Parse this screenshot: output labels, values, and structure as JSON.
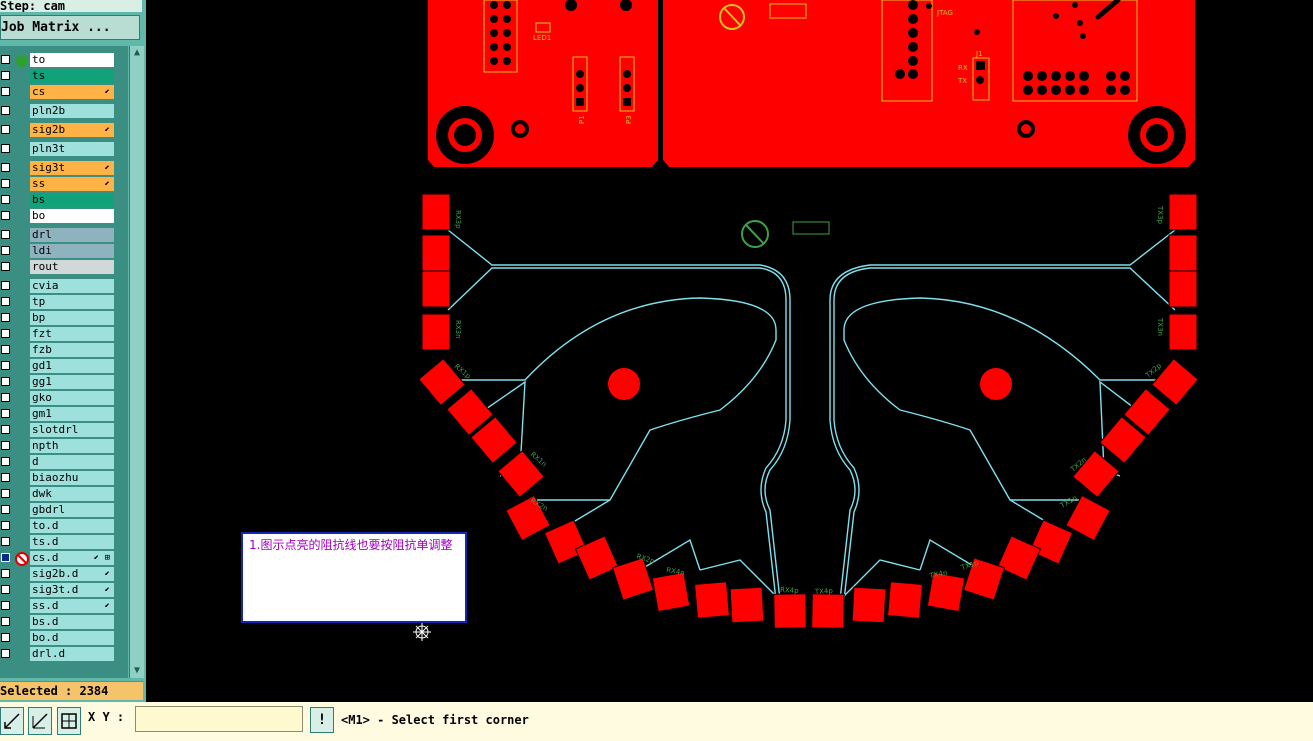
{
  "step_label": "Step: cam",
  "job_matrix_label": "Job Matrix ...",
  "colors": {
    "board": "#ff0000",
    "trace": "#7fe0ee",
    "silk": "#3ea04a",
    "silk_yellow": "#d8c020",
    "signal_layer": "#ffb347",
    "solder_layer": "#12a27a",
    "drill_layer": "#8fb2bf",
    "default_layer": "#9ee0dc",
    "white_layer": "#ffffff"
  },
  "layers": [
    {
      "name": "to",
      "color": "#ffffff",
      "indicator": "active-dot"
    },
    {
      "name": "ts",
      "color": "#12a27a"
    },
    {
      "name": "cs",
      "color": "#ffb347",
      "mark": "⬋"
    },
    {
      "name": "pln2b",
      "color": "#9ee0dc"
    },
    {
      "name": "sig2b",
      "color": "#ffb347",
      "mark": "⬋"
    },
    {
      "name": "pln3t",
      "color": "#9ee0dc"
    },
    {
      "name": "sig3t",
      "color": "#ffb347",
      "mark": "⬋"
    },
    {
      "name": "ss",
      "color": "#ffb347",
      "mark": "⬋"
    },
    {
      "name": "bs",
      "color": "#12a27a"
    },
    {
      "name": "bo",
      "color": "#ffffff"
    },
    {
      "name": "drl",
      "color": "#8fb2bf"
    },
    {
      "name": "ldi",
      "color": "#8fb2bf"
    },
    {
      "name": "rout",
      "color": "#d0d8d8"
    },
    {
      "name": "cvia",
      "color": "#9ee0dc"
    },
    {
      "name": "tp",
      "color": "#9ee0dc"
    },
    {
      "name": "bp",
      "color": "#9ee0dc"
    },
    {
      "name": "fzt",
      "color": "#9ee0dc"
    },
    {
      "name": "fzb",
      "color": "#9ee0dc"
    },
    {
      "name": "gd1",
      "color": "#9ee0dc"
    },
    {
      "name": "gg1",
      "color": "#9ee0dc"
    },
    {
      "name": "gko",
      "color": "#9ee0dc"
    },
    {
      "name": "gm1",
      "color": "#9ee0dc"
    },
    {
      "name": "slotdrl",
      "color": "#9ee0dc"
    },
    {
      "name": "npth",
      "color": "#9ee0dc"
    },
    {
      "name": "d",
      "color": "#9ee0dc"
    },
    {
      "name": "biaozhu",
      "color": "#9ee0dc"
    },
    {
      "name": "dwk",
      "color": "#9ee0dc"
    },
    {
      "name": "gbdrl",
      "color": "#9ee0dc"
    },
    {
      "name": "to.d",
      "color": "#9ee0dc"
    },
    {
      "name": "ts.d",
      "color": "#9ee0dc"
    },
    {
      "name": "cs.d",
      "color": "#9ee0dc",
      "mark": "⬋ ⊞",
      "indicator": "no-entry",
      "selected": true
    },
    {
      "name": "sig2b.d",
      "color": "#9ee0dc",
      "mark": "⬋"
    },
    {
      "name": "sig3t.d",
      "color": "#9ee0dc",
      "mark": "⬋"
    },
    {
      "name": "ss.d",
      "color": "#9ee0dc",
      "mark": "⬋"
    },
    {
      "name": "bs.d",
      "color": "#9ee0dc"
    },
    {
      "name": "bo.d",
      "color": "#9ee0dc"
    },
    {
      "name": "drl.d",
      "color": "#9ee0dc"
    }
  ],
  "selected_label": "Selected : 2384",
  "xy_label": "X Y :",
  "xy_value": "",
  "exclaim_label": "!",
  "status_text": "<M1> - Select first corner",
  "note_text": "1.图示点亮的阻抗线也要按阻抗单调整",
  "pcb_labels": {
    "led": "LED1",
    "jtag": "JTAG",
    "j1": "J1",
    "rx": "RX",
    "tx": "TX",
    "p1": "P1",
    "p3": "P3",
    "rx3p": "RX3p",
    "rx3n": "RX3n",
    "tx3p": "TX3p",
    "tx3n": "TX3n",
    "rx1p": "RX1p",
    "rx1n": "RX1n",
    "rx2p": "RX2p",
    "rx2n": "RX2n",
    "rx4p": "RX4p",
    "rx4n": "RX4n",
    "tx1p": "TX1p",
    "tx1n": "TX1n",
    "tx2p": "TX2p",
    "tx2n": "TX2n",
    "tx4p": "TX4p",
    "tx4n": "TX4n"
  }
}
